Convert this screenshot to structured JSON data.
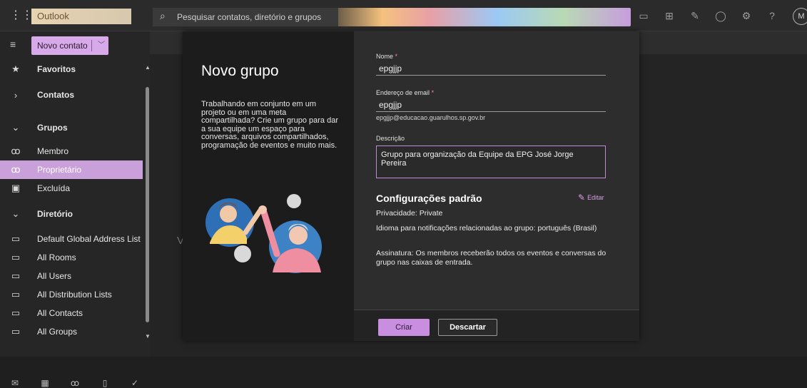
{
  "app": {
    "brand": "Outlook",
    "search_placeholder": "Pesquisar contatos, diretório e grupos",
    "avatar_initial": "M"
  },
  "toolbar": {
    "new_contact_label": "Novo contato"
  },
  "sidebar": {
    "items": [
      {
        "label": "Favoritos",
        "icon": "star-icon",
        "glyph": "★"
      },
      {
        "label": "Contatos",
        "icon": "chevron-right-icon",
        "glyph": "›"
      },
      {
        "label": "Grupos",
        "icon": "chevron-down-icon",
        "glyph": "⌄"
      },
      {
        "label": "Membro",
        "icon": "people-icon",
        "glyph": "ꝏ"
      },
      {
        "label": "Proprietário",
        "icon": "people-owner-icon",
        "glyph": "ꝏ"
      },
      {
        "label": "Excluída",
        "icon": "trash-icon",
        "glyph": "🗑"
      },
      {
        "label": "Diretório",
        "icon": "chevron-down-icon",
        "glyph": "⌄"
      },
      {
        "label": "Default Global Address List",
        "icon": "folder-icon",
        "glyph": "▭"
      },
      {
        "label": "All Rooms",
        "icon": "folder-icon",
        "glyph": "▭"
      },
      {
        "label": "All Users",
        "icon": "folder-icon",
        "glyph": "▭"
      },
      {
        "label": "All Distribution Lists",
        "icon": "folder-icon",
        "glyph": "▭"
      },
      {
        "label": "All Contacts",
        "icon": "folder-icon",
        "glyph": "▭"
      },
      {
        "label": "All Groups",
        "icon": "folder-icon",
        "glyph": "▭"
      }
    ]
  },
  "main": {
    "ghost_letter": "V"
  },
  "modal": {
    "title": "Novo grupo",
    "description": "Trabalhando em conjunto em um projeto ou em uma meta compartilhada? Crie um grupo para dar a sua equipe um espaço para conversas, arquivos compartilhados, programação de eventos e muito mais.",
    "name_label": "Nome",
    "name_value": "epgjjp",
    "email_label": "Endereço de email",
    "email_value": "epgjjp",
    "email_hint": "epgjjp@educacao.guarulhos.sp.gov.br",
    "description_label": "Descrição",
    "description_value": "Grupo para organização da Equipe da EPG José Jorge Pereira",
    "settings_title": "Configurações padrão",
    "edit_label": "Editar",
    "privacy": "Privacidade: Private",
    "language": "Idioma para notificações relacionadas ao grupo: português (Brasil)",
    "subscription": "Assinatura: Os membros receberão todos os eventos e conversas do grupo nas caixas de entrada.",
    "required_mark": "*",
    "create_label": "Criar",
    "discard_label": "Descartar"
  },
  "colors": {
    "accent": "#c98ee0",
    "active_item": "#c9a0da"
  }
}
